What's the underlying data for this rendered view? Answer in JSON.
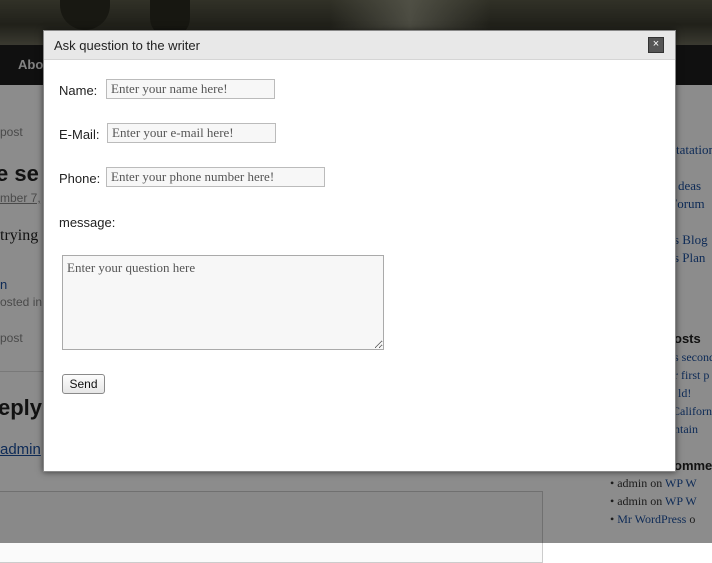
{
  "background": {
    "nav_item": "Abo",
    "post_label_1": "post",
    "post_title": "e se",
    "post_date": "mber 7,",
    "post_excerpt": "trying",
    "post_link": "n",
    "posted_in": "osted in",
    "post_label_2": "post",
    "reply_heading": "eply",
    "reply_user": "admin",
    "sidebar": {
      "links_top": [
        "tatation",
        "deas",
        "Forum"
      ],
      "links_mid": [
        "s Blog",
        "s Plan"
      ],
      "recent_posts_heading": "osts",
      "recent_posts": [
        "s second",
        "r first p",
        "ld!",
        "Californ",
        "ntain"
      ],
      "recent_comments_heading": "omme",
      "comments": [
        {
          "author": "admin",
          "on": "on",
          "post": "WP W"
        },
        {
          "author": "admin",
          "on": "on",
          "post": "WP W"
        },
        {
          "author": "Mr WordPress",
          "on": "o",
          "post": ""
        }
      ]
    }
  },
  "modal": {
    "title": "Ask question to the writer",
    "close_symbol": "×",
    "fields": {
      "name": {
        "label": "Name:",
        "placeholder": "Enter your name here!"
      },
      "email": {
        "label": "E-Mail:",
        "placeholder": "Enter your e-mail here!"
      },
      "phone": {
        "label": "Phone:",
        "placeholder": "Enter your phone number here!"
      },
      "message": {
        "label": "message:",
        "placeholder": "Enter your question here"
      }
    },
    "send_label": "Send"
  }
}
